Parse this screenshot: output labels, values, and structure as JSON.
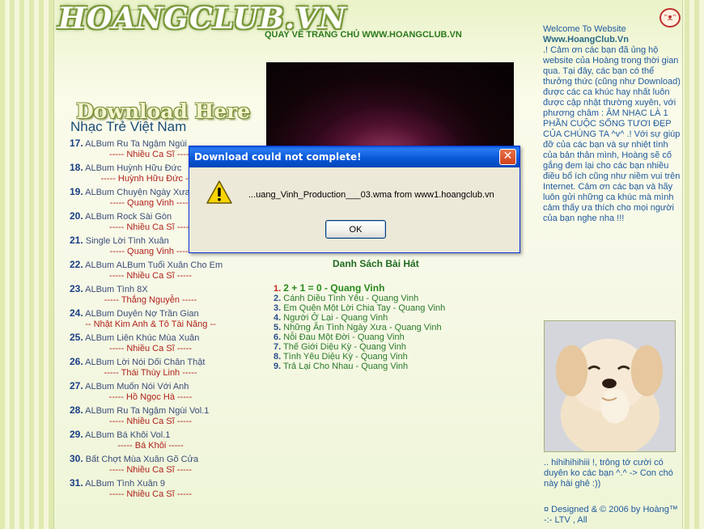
{
  "header": {
    "logo_text": "HOANGCLUB.VN",
    "home_link": "QUAY VỀ TRANG CHỦ WWW.HOANGCLUB.VN"
  },
  "left": {
    "download_title": "Download Here",
    "section_title": "Nhạc Trẻ Việt Nam",
    "albums": [
      {
        "num": "17.",
        "title": "ALBum Ru Ta Ngậm Ngùi",
        "artist": "----- Nhiều Ca Sĩ -----"
      },
      {
        "num": "18.",
        "title": "ALBum Huỳnh Hữu Đức",
        "artist": "----- Huỳnh Hữu Đức -----"
      },
      {
        "num": "19.",
        "title": "ALBum Chuyện Ngày Xưa",
        "artist": "----- Quang Vinh -----"
      },
      {
        "num": "20.",
        "title": "ALBum Rock Sài Gòn",
        "artist": "----- Nhiều Ca Sĩ -----"
      },
      {
        "num": "21.",
        "title": "Single Lời Tình Xuân",
        "artist": "----- Quang Vinh -----"
      },
      {
        "num": "22.",
        "title": "ALBum ALBum Tuổi Xuân Cho Em",
        "artist": "----- Nhiều Ca Sĩ -----"
      },
      {
        "num": "23.",
        "title": "ALBum Tình 8X",
        "artist": "----- Thắng Nguyễn -----"
      },
      {
        "num": "24.",
        "title": "ALBum Duyên Nợ Trần Gian",
        "artist": "-- Nhật Kim Anh & Tô Tài Năng --"
      },
      {
        "num": "25.",
        "title": "ALBum Liên Khúc Mùa Xuân",
        "artist": "----- Nhiều Ca Sĩ -----"
      },
      {
        "num": "26.",
        "title": "ALBum Lời Nói Dối Chân Thật",
        "artist": "----- Thái Thùy Linh -----"
      },
      {
        "num": "27.",
        "title": "ALBum Muốn Nói Với Anh",
        "artist": "----- Hồ Ngọc Hà -----"
      },
      {
        "num": "28.",
        "title": "ALBum Ru Ta Ngậm Ngùi Vol.1",
        "artist": "----- Nhiều Ca Sĩ -----"
      },
      {
        "num": "29.",
        "title": "ALBum Bá Khôi Vol.1",
        "artist": "----- Bá Khôi -----"
      },
      {
        "num": "30.",
        "title": "Bất Chợt Mùa Xuân Gõ Cửa",
        "artist": "----- Nhiều Ca Sĩ -----"
      },
      {
        "num": "31.",
        "title": "ALBum Tình Xuân 9",
        "artist": "----- Nhiều Ca Sĩ -----"
      }
    ]
  },
  "center": {
    "songs_title": "Danh Sách Bài Hát",
    "songs": [
      {
        "num": "1.",
        "text": "2 + 1 = 0 - Quang Vinh"
      },
      {
        "num": "2.",
        "text": "Cánh Diều Tình Yêu - Quang Vinh"
      },
      {
        "num": "3.",
        "text": "Em Quên Một Lời Chia Tay - Quang Vinh"
      },
      {
        "num": "4.",
        "text": "Người Ở Lại - Quang Vinh"
      },
      {
        "num": "5.",
        "text": "Những Ân Tình Ngày Xưa - Quang Vinh"
      },
      {
        "num": "6.",
        "text": "Nỗi Đau Một Đời - Quang Vinh"
      },
      {
        "num": "7.",
        "text": "Thế Giới Diệu Kỳ - Quang Vinh"
      },
      {
        "num": "8.",
        "text": "Tình Yêu Diệu Kỳ - Quang Vinh"
      },
      {
        "num": "9.",
        "text": "Trả Lại Cho Nhau - Quang Vinh"
      }
    ]
  },
  "sidebar": {
    "welcome": "Welcome To Website",
    "site_name": "Www.HoangClub.Vn",
    "intro": ".! Cảm ơn các bạn đã ủng hộ website của Hoàng trong thời gian qua. Tại đây, các bạn có thể thưởng thức (cũng như Download) được các ca khúc hay nhất luôn được cập nhật thường xuyên, với phương châm : ÂM NHẠC LÀ 1 PHẦN CUỘC SỐNG TƯƠI ĐẸP CỦA CHÚNG TA ^v^ .! Với sự giúp đỡ của các bạn và sự nhiệt tình của bản thân mình, Hoàng sẽ cố gắng đem lại cho các bạn nhiều điều bổ ích cũng như niềm vui trên Internet. Cảm ơn các bạn và hãy luôn gửi những ca khúc mà mình cảm thấy ưa thích cho mọi người của bạn nghe nha !!!",
    "caption": ".. hihihihihiii !, trông tớ cười có duyên ko các bạn ^.^ -> Con chó này hài ghê :))",
    "credit": "¤ Designed & © 2006 by Hoàng™ -:- LTV , All"
  },
  "dialog": {
    "title": "Download could not complete!",
    "message": "...uang_Vinh_Production___03.wma from www1.hoangclub.vn",
    "ok_label": "OK",
    "close_label": "✕"
  },
  "colors": {
    "titlebar": "#0a58d8",
    "accent_green": "#2b7a1c",
    "artist_red": "#b0211c"
  }
}
